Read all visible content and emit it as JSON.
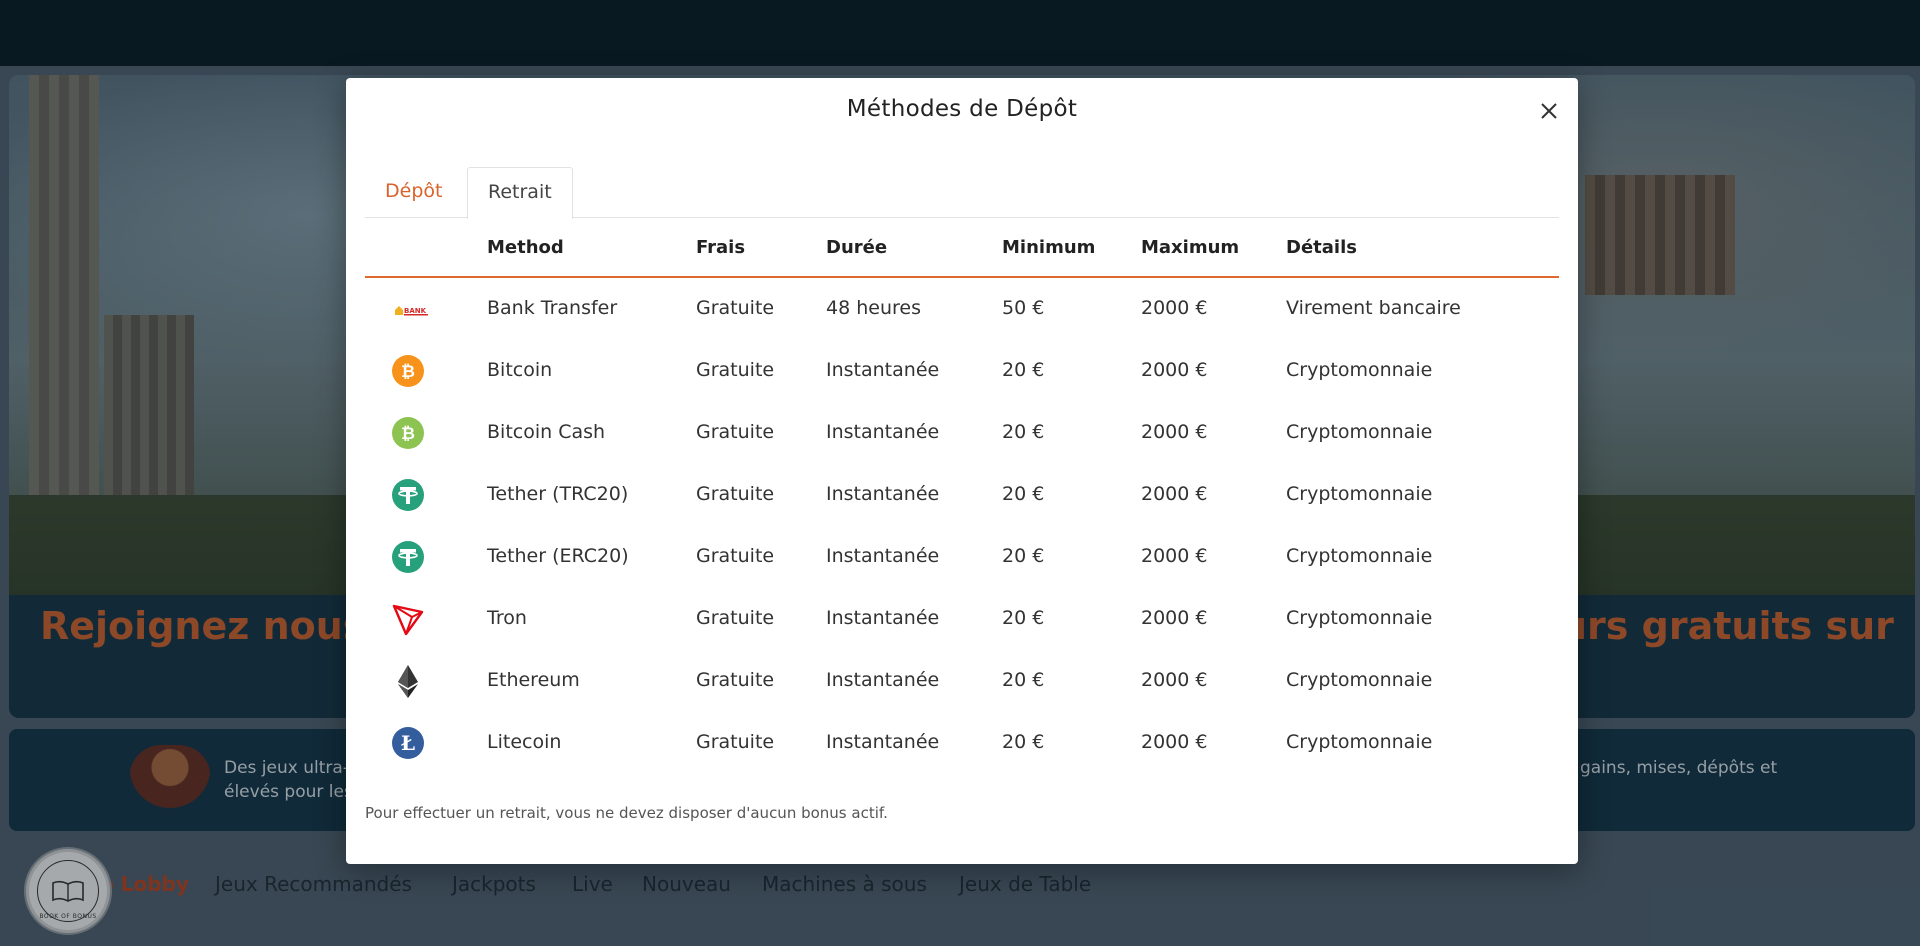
{
  "background": {
    "hero_left_text": "Rejoignez nous",
    "hero_right_text": "urs gratuits sur",
    "promo_left_line1": "Des jeux ultra-",
    "promo_left_line2": "élevés pour les",
    "promo_right_line1": "gains, mises, dépôts et",
    "nav": {
      "active": "o Lobby",
      "items": [
        "Jeux Recommandés",
        "Jackpots",
        "Live",
        "Nouveau",
        "Machines à sous",
        "Jeux de Table"
      ]
    },
    "logo_text": "BOOK OF BONUS"
  },
  "modal": {
    "title": "Méthodes de Dépôt",
    "tabs": [
      {
        "label": "Dépôt",
        "active": false
      },
      {
        "label": "Retrait",
        "active": true
      }
    ],
    "columns": [
      "Method",
      "Frais",
      "Durée",
      "Minimum",
      "Maximum",
      "Détails"
    ],
    "rows": [
      {
        "icon": "bank-transfer-icon",
        "method": "Bank Transfer",
        "fees": "Gratuite",
        "duration": "48 heures",
        "min": "50 €",
        "max": "2000 €",
        "details": "Virement bancaire"
      },
      {
        "icon": "bitcoin-icon",
        "method": "Bitcoin",
        "fees": "Gratuite",
        "duration": "Instantanée",
        "min": "20 €",
        "max": "2000 €",
        "details": "Cryptomonnaie"
      },
      {
        "icon": "bitcoin-cash-icon",
        "method": "Bitcoin Cash",
        "fees": "Gratuite",
        "duration": "Instantanée",
        "min": "20 €",
        "max": "2000 €",
        "details": "Cryptomonnaie"
      },
      {
        "icon": "tether-icon",
        "method": "Tether (TRC20)",
        "fees": "Gratuite",
        "duration": "Instantanée",
        "min": "20 €",
        "max": "2000 €",
        "details": "Cryptomonnaie"
      },
      {
        "icon": "tether-icon",
        "method": "Tether (ERC20)",
        "fees": "Gratuite",
        "duration": "Instantanée",
        "min": "20 €",
        "max": "2000 €",
        "details": "Cryptomonnaie"
      },
      {
        "icon": "tron-icon",
        "method": "Tron",
        "fees": "Gratuite",
        "duration": "Instantanée",
        "min": "20 €",
        "max": "2000 €",
        "details": "Cryptomonnaie"
      },
      {
        "icon": "ethereum-icon",
        "method": "Ethereum",
        "fees": "Gratuite",
        "duration": "Instantanée",
        "min": "20 €",
        "max": "2000 €",
        "details": "Cryptomonnaie"
      },
      {
        "icon": "litecoin-icon",
        "method": "Litecoin",
        "fees": "Gratuite",
        "duration": "Instantanée",
        "min": "20 €",
        "max": "2000 €",
        "details": "Cryptomonnaie"
      }
    ],
    "note": "Pour effectuer un retrait, vous ne devez disposer d'aucun bonus actif."
  },
  "colors": {
    "accent": "#e06a2e",
    "topbar": "#031821",
    "banner": "#123345",
    "bitcoin": "#f7931a",
    "bitcoin_cash": "#8dc351",
    "tether": "#26a17b",
    "tron": "#e50915",
    "litecoin": "#345d9d"
  }
}
